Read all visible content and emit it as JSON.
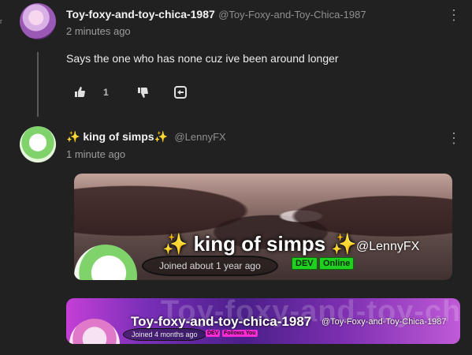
{
  "edge": {
    "glyph": "ᵣ"
  },
  "comments": [
    {
      "author": "Toy-foxy-and-toy-chica-1987",
      "handle": "@Toy-Foxy-and-Toy-Chica-1987",
      "time": "2 minutes ago",
      "text": "Says the one who has none cuz ive been around longer",
      "likes": "1"
    },
    {
      "author_prefix": "✨",
      "author": " king of simps",
      "author_suffix": "✨",
      "handle": "@LennyFX",
      "time": "1 minute ago"
    }
  ],
  "banner1": {
    "name_prefix": "✨",
    "name": " king of simps ",
    "name_suffix": "✨",
    "handle": "@LennyFX",
    "joined": "Joined about 1 year ago",
    "badges": [
      "DEV",
      "Online"
    ]
  },
  "banner2": {
    "watermark": "Toy-foxy-and-toy-ch",
    "name": "Toy-foxy-and-toy-chica-1987",
    "handle": "@Toy-Foxy-and-Toy-Chica-1987",
    "joined": "Joined 4 months ago",
    "badges": [
      "DEV",
      "Follows You"
    ]
  },
  "icons": {
    "like": "thumbs-up-icon",
    "dislike": "thumbs-down-icon",
    "reply": "reply-icon",
    "menu": "kebab-menu-icon"
  }
}
